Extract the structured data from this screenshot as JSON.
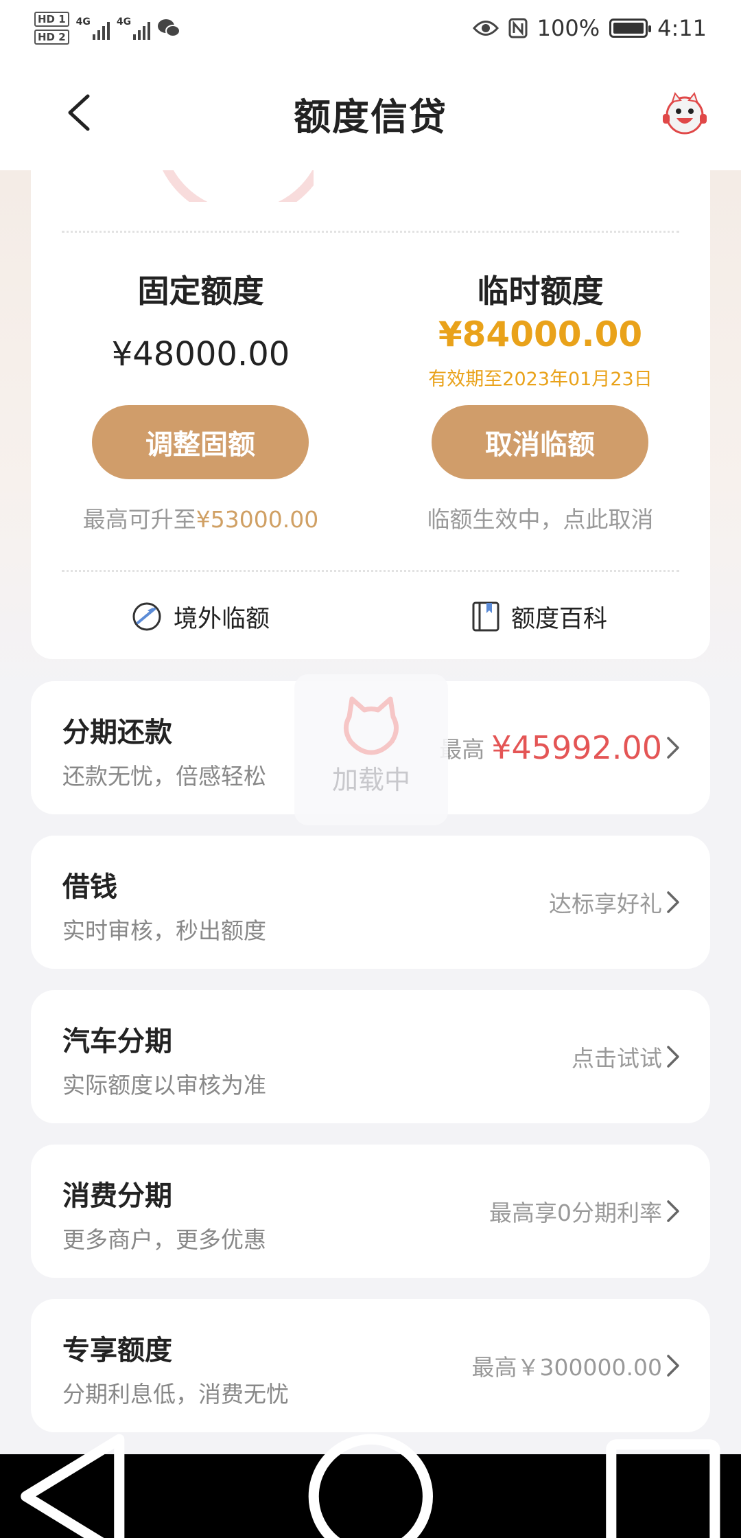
{
  "status_bar": {
    "hd1": "HD 1",
    "hd2": "HD 2",
    "net1": "4G",
    "net2": "4G",
    "battery": "100%",
    "time": "4:11"
  },
  "nav": {
    "title": "额度信贷"
  },
  "credit": {
    "fixed": {
      "title": "固定额度",
      "amount": "¥48000.00",
      "button": "调整固额",
      "hint_prefix": "最高可升至",
      "hint_amount": "¥53000.00"
    },
    "temporary": {
      "title": "临时额度",
      "amount": "¥84000.00",
      "validity": "有效期至2023年01月23日",
      "button": "取消临额",
      "hint": "临额生效中，点此取消"
    },
    "links": {
      "overseas": "境外临额",
      "encyclopedia": "额度百科"
    }
  },
  "items": [
    {
      "title": "分期还款",
      "subtitle": "还款无忧，倍感轻松",
      "right_prefix": "最高",
      "right_value": "¥45992.00"
    },
    {
      "title": "借钱",
      "subtitle": "实时审核，秒出额度",
      "right": "达标享好礼"
    },
    {
      "title": "汽车分期",
      "subtitle": "实际额度以审核为准",
      "right": "点击试试"
    },
    {
      "title": "消费分期",
      "subtitle": "更多商户，更多优惠",
      "right": "最高享0分期利率"
    },
    {
      "title": "专享额度",
      "subtitle": "分期利息低，消费无忧",
      "right": "最高￥300000.00"
    }
  ],
  "loading": {
    "text": "加载中"
  },
  "colors": {
    "accent_gold": "#d09d6a",
    "temp_amount": "#e9a21a",
    "highlight_red": "#e45555"
  }
}
